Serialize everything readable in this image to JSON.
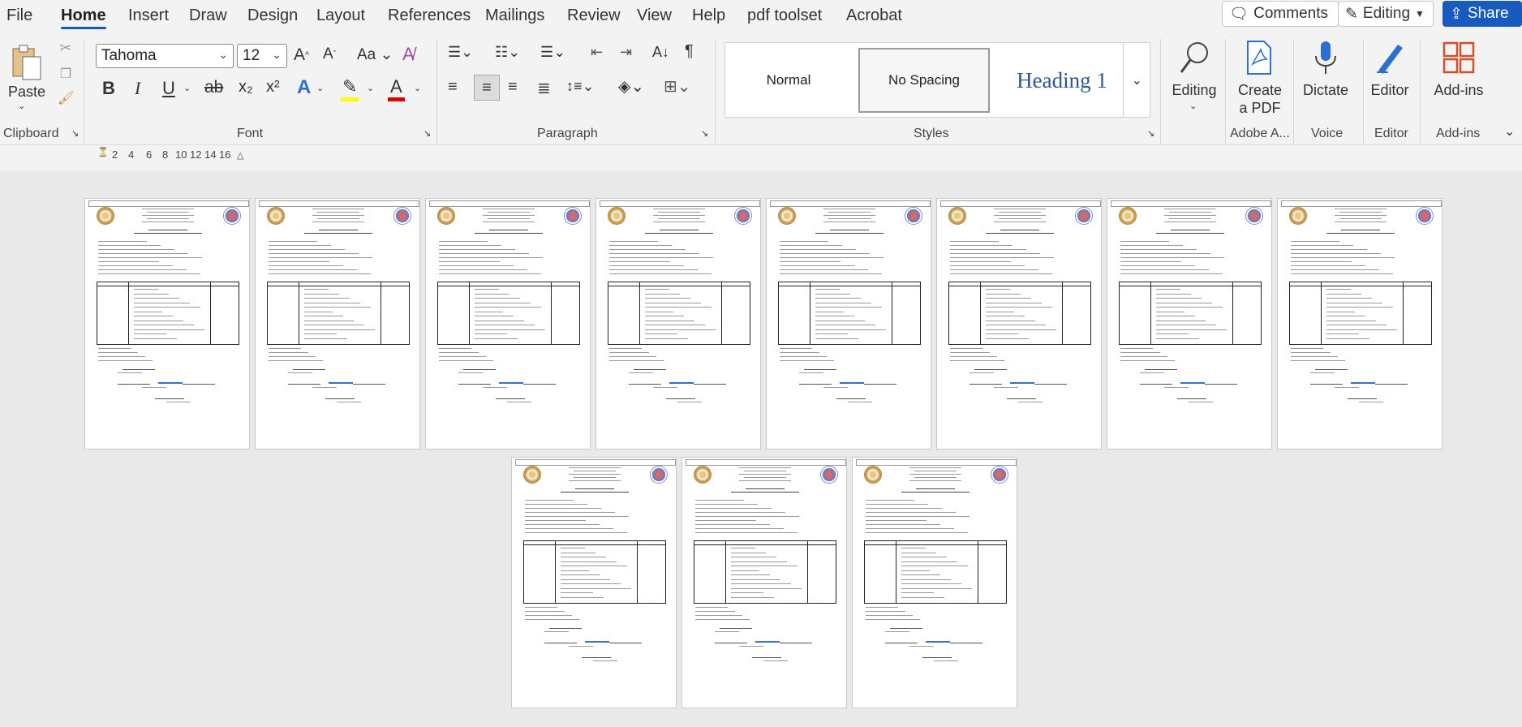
{
  "menu": {
    "items": [
      "File",
      "Home",
      "Insert",
      "Draw",
      "Design",
      "Layout",
      "References",
      "Mailings",
      "Review",
      "View",
      "Help",
      "pdf toolset",
      "Acrobat"
    ],
    "active": "Home",
    "comments": "Comments",
    "editing": "Editing",
    "share": "Share"
  },
  "ribbon": {
    "clipboard": {
      "paste": "Paste",
      "label": "Clipboard"
    },
    "font": {
      "name": "Tahoma",
      "size": "12",
      "label": "Font",
      "grow": "A^",
      "shrink": "A˅",
      "case": "Aa",
      "bold": "B",
      "italic": "I",
      "underline": "U",
      "strike": "ab",
      "sub": "x₂",
      "sup": "x²"
    },
    "paragraph": {
      "label": "Paragraph"
    },
    "styles": {
      "label": "Styles",
      "items": [
        "Normal",
        "No Spacing",
        "Heading 1"
      ]
    },
    "editing_group": {
      "label": "Editing"
    },
    "adobe": {
      "line1": "Create",
      "line2": "a PDF",
      "label": "Adobe A..."
    },
    "voice": {
      "button": "Dictate",
      "label": "Voice"
    },
    "editor": {
      "button": "Editor",
      "label": "Editor"
    },
    "addins": {
      "button": "Add-ins",
      "label": "Add-ins"
    }
  },
  "ruler": {
    "ticks": [
      "2",
      "4",
      "6",
      "8",
      "10",
      "12",
      "14",
      "16"
    ]
  },
  "document": {
    "page_count": 11
  },
  "colors": {
    "accent": "#185abd",
    "highlight": "#ffff00",
    "font_color": "#e00000"
  }
}
